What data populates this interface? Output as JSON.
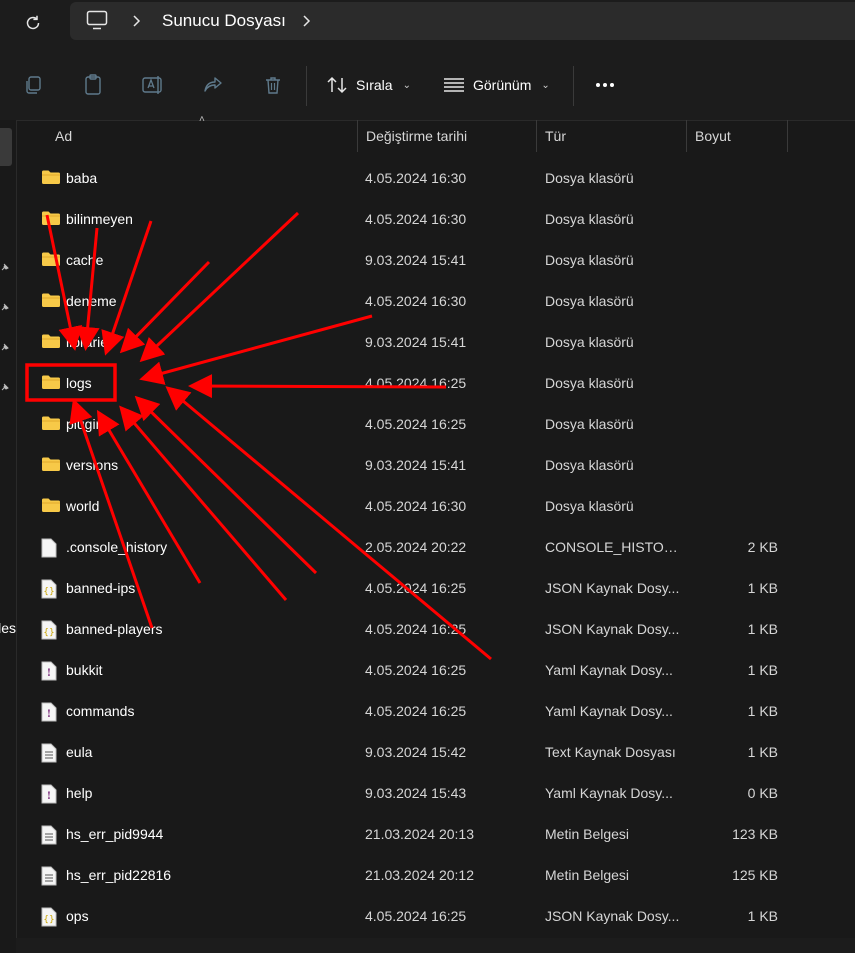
{
  "address": {
    "breadcrumb": "Sunucu Dosyası"
  },
  "toolbar": {
    "sort_label": "Sırala",
    "view_label": "Görünüm"
  },
  "nav": {
    "partial_label": "les"
  },
  "columns": {
    "name": "Ad",
    "date": "Değiştirme tarihi",
    "type": "Tür",
    "size": "Boyut"
  },
  "files": [
    {
      "name": "baba",
      "date": "4.05.2024 16:30",
      "type": "Dosya klasörü",
      "size": "",
      "icon": "folder-icon"
    },
    {
      "name": "bilinmeyen",
      "date": "4.05.2024 16:30",
      "type": "Dosya klasörü",
      "size": "",
      "icon": "folder-icon"
    },
    {
      "name": "cache",
      "date": "9.03.2024 15:41",
      "type": "Dosya klasörü",
      "size": "",
      "icon": "folder-icon"
    },
    {
      "name": "deneme",
      "date": "4.05.2024 16:30",
      "type": "Dosya klasörü",
      "size": "",
      "icon": "folder-icon"
    },
    {
      "name": "libraries",
      "date": "9.03.2024 15:41",
      "type": "Dosya klasörü",
      "size": "",
      "icon": "folder-icon"
    },
    {
      "name": "logs",
      "date": "4.05.2024 16:25",
      "type": "Dosya klasörü",
      "size": "",
      "icon": "folder-icon"
    },
    {
      "name": "plugins",
      "date": "4.05.2024 16:25",
      "type": "Dosya klasörü",
      "size": "",
      "icon": "folder-icon"
    },
    {
      "name": "versions",
      "date": "9.03.2024 15:41",
      "type": "Dosya klasörü",
      "size": "",
      "icon": "folder-icon"
    },
    {
      "name": "world",
      "date": "4.05.2024 16:30",
      "type": "Dosya klasörü",
      "size": "",
      "icon": "folder-icon"
    },
    {
      "name": ".console_history",
      "date": "2.05.2024 20:22",
      "type": "CONSOLE_HISTOR...",
      "size": "2 KB",
      "icon": "file-icon"
    },
    {
      "name": "banned-ips",
      "date": "4.05.2024 16:25",
      "type": "JSON Kaynak Dosy...",
      "size": "1 KB",
      "icon": "json-file-icon"
    },
    {
      "name": "banned-players",
      "date": "4.05.2024 16:25",
      "type": "JSON Kaynak Dosy...",
      "size": "1 KB",
      "icon": "json-file-icon"
    },
    {
      "name": "bukkit",
      "date": "4.05.2024 16:25",
      "type": "Yaml Kaynak Dosy...",
      "size": "1 KB",
      "icon": "yaml-file-icon"
    },
    {
      "name": "commands",
      "date": "4.05.2024 16:25",
      "type": "Yaml Kaynak Dosy...",
      "size": "1 KB",
      "icon": "yaml-file-icon"
    },
    {
      "name": "eula",
      "date": "9.03.2024 15:42",
      "type": "Text Kaynak Dosyası",
      "size": "1 KB",
      "icon": "text-file-icon"
    },
    {
      "name": "help",
      "date": "9.03.2024 15:43",
      "type": "Yaml Kaynak Dosy...",
      "size": "0 KB",
      "icon": "yaml-file-icon"
    },
    {
      "name": "hs_err_pid9944",
      "date": "21.03.2024 20:13",
      "type": "Metin Belgesi",
      "size": "123 KB",
      "icon": "text-file-icon"
    },
    {
      "name": "hs_err_pid22816",
      "date": "21.03.2024 20:12",
      "type": "Metin Belgesi",
      "size": "125 KB",
      "icon": "text-file-icon"
    },
    {
      "name": "ops",
      "date": "4.05.2024 16:25",
      "type": "JSON Kaynak Dosy...",
      "size": "1 KB",
      "icon": "json-file-icon"
    }
  ],
  "colors": {
    "folder": "#f7c948",
    "annotation": "#ff0000"
  }
}
